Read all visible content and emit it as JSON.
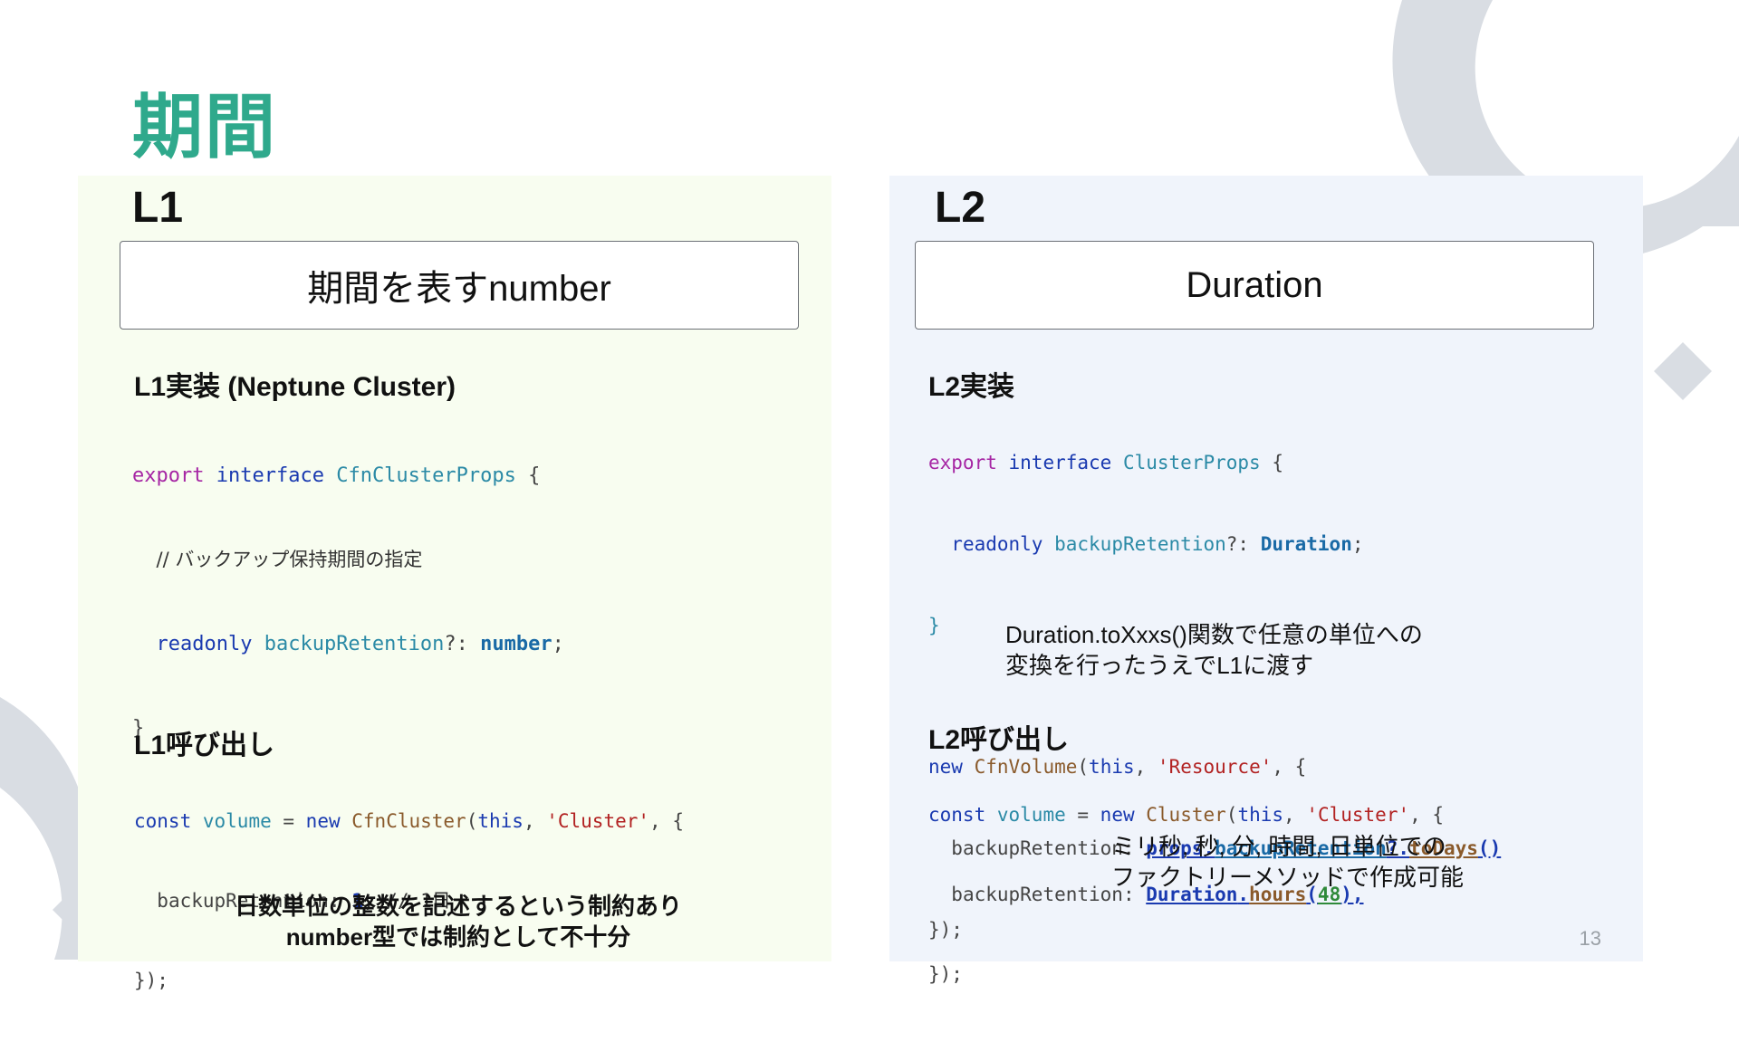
{
  "slide": {
    "title": "期間",
    "page_number": "13"
  },
  "l1": {
    "level": "L1",
    "box_label": "期間を表すnumber",
    "impl_heading": "L1実装 (Neptune Cluster)",
    "impl_code": {
      "line1": {
        "export": "export",
        "interface": "interface",
        "name": "CfnClusterProps",
        "brace": " {"
      },
      "line2": {
        "comment": "// バックアップ保持期間の指定"
      },
      "line3": {
        "readonly": "readonly",
        "prop": "backupRetention",
        "opt": "?: ",
        "type": "number",
        "semi": ";"
      },
      "line4": {
        "close": "}"
      }
    },
    "call_heading": "L1呼び出し",
    "call_code": {
      "line1": {
        "const": "const",
        "var": "volume",
        "eq": " = ",
        "new": "new",
        "cls": "CfnCluster",
        "open": "(",
        "this": "this",
        "comma": ", ",
        "str": "'Cluster'",
        "rest": ", {"
      },
      "line2": {
        "prop": "backupRetention: ",
        "num": "1",
        "rest": ", // 1日"
      },
      "line3": {
        "close": "});"
      }
    },
    "note_line1": "日数単位の整数を記述するという制約あり",
    "note_line2": "number型では制約として不十分"
  },
  "l2": {
    "level": "L2",
    "box_label": "Duration",
    "impl_heading": "L2実装",
    "impl_code": {
      "line1": {
        "export": "export",
        "interface": "interface",
        "name": "ClusterProps",
        "brace": " {"
      },
      "line2": {
        "readonly": "readonly",
        "prop": "backupRetention",
        "opt": "?: ",
        "type": "Duration",
        "semi": ";"
      },
      "line3": {
        "close": "}"
      },
      "line4": {
        "new": "new",
        "cls": "CfnVolume",
        "open": "(",
        "this": "this",
        "comma": ", ",
        "str": "'Resource'",
        "rest": ", {"
      },
      "line5": {
        "prop": "backupRetention: ",
        "props": "props",
        "dot1": ".",
        "member": "backupRetention",
        "opt": "?.",
        "method": "toDays",
        "call": "()"
      },
      "line6": {
        "close": "});"
      }
    },
    "impl_note_line1": "Duration.toXxxs()関数で任意の単位への",
    "impl_note_line2": "変換を行ったうえでL1に渡す",
    "call_heading": "L2呼び出し",
    "call_code": {
      "line1": {
        "const": "const",
        "var": "volume",
        "eq": " = ",
        "new": "new",
        "cls": "Cluster",
        "open": "(",
        "this": "this",
        "comma": ", ",
        "str": "'Cluster'",
        "rest": ", {"
      },
      "line2": {
        "prop": "backupRetention: ",
        "dur": "Duration",
        "dot": ".",
        "method": "hours",
        "open": "(",
        "num": "48",
        "rest": "),"
      },
      "line3": {
        "close": "});"
      }
    },
    "call_note_line1": "ミリ秒, 秒, 分, 時間, 日単位での",
    "call_note_line2": "ファクトリーメソッドで作成可能"
  },
  "colors": {
    "title": "#2fa98c",
    "l1_panel": "#f8fdf0",
    "l2_panel": "#f0f4fb",
    "decoration": "#d9dde3"
  }
}
